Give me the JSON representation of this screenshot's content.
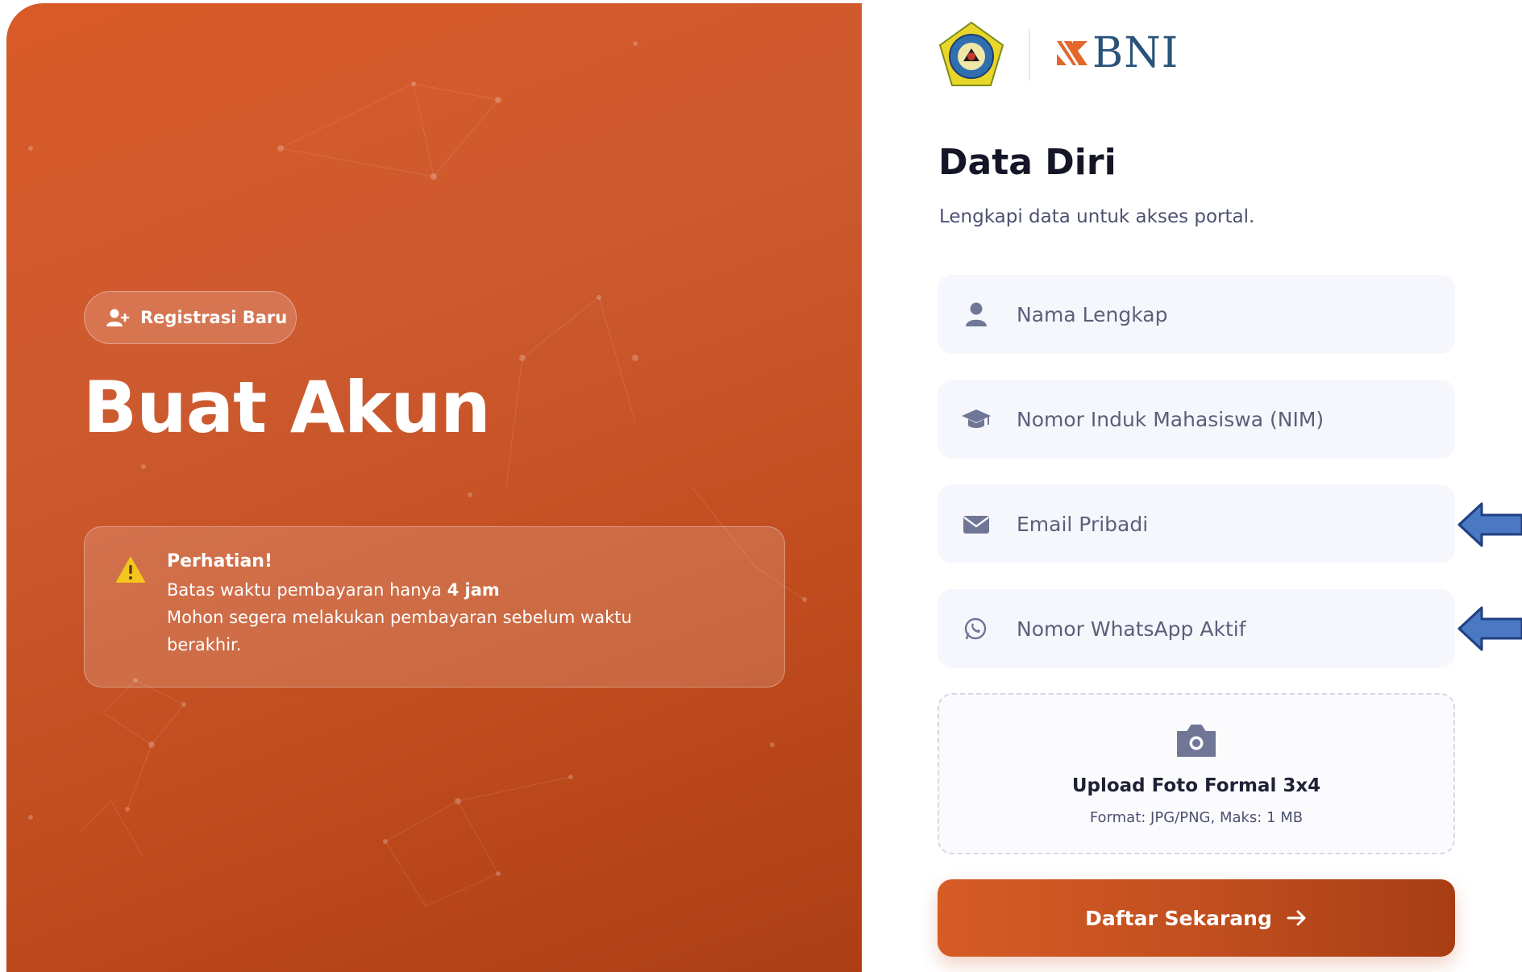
{
  "hero": {
    "badge_label": "Registrasi Baru",
    "title": "Buat Akun",
    "notice": {
      "heading": "Perhatian!",
      "line1_prefix": "Batas waktu pembayaran hanya ",
      "line1_bold": "4 jam",
      "line2": "Mohon segera melakukan pembayaran sebelum waktu",
      "line3": "berakhir."
    },
    "colors": {
      "gradient_start": "#d85a27",
      "gradient_end": "#ad3e14"
    }
  },
  "header": {
    "brand_text": "BNI",
    "brand_color": "#2a5378"
  },
  "form": {
    "title": "Data Diri",
    "subtitle": "Lengkapi data untuk akses portal.",
    "fields": [
      {
        "icon": "user-icon",
        "placeholder": "Nama Lengkap",
        "value": ""
      },
      {
        "icon": "graduation-cap-icon",
        "placeholder": "Nomor Induk Mahasiswa (NIM)",
        "value": ""
      },
      {
        "icon": "envelope-icon",
        "placeholder": "Email Pribadi",
        "value": ""
      },
      {
        "icon": "whatsapp-icon",
        "placeholder": "Nomor WhatsApp Aktif",
        "value": ""
      }
    ],
    "upload": {
      "icon": "camera-icon",
      "label": "Upload Foto Formal 3x4",
      "hint": "Format: JPG/PNG, Maks: 1 MB"
    },
    "submit_label": "Daftar Sekarang",
    "accent_color": "#c24f1f"
  },
  "annotations": {
    "arrow_color": "#4a78c2"
  }
}
